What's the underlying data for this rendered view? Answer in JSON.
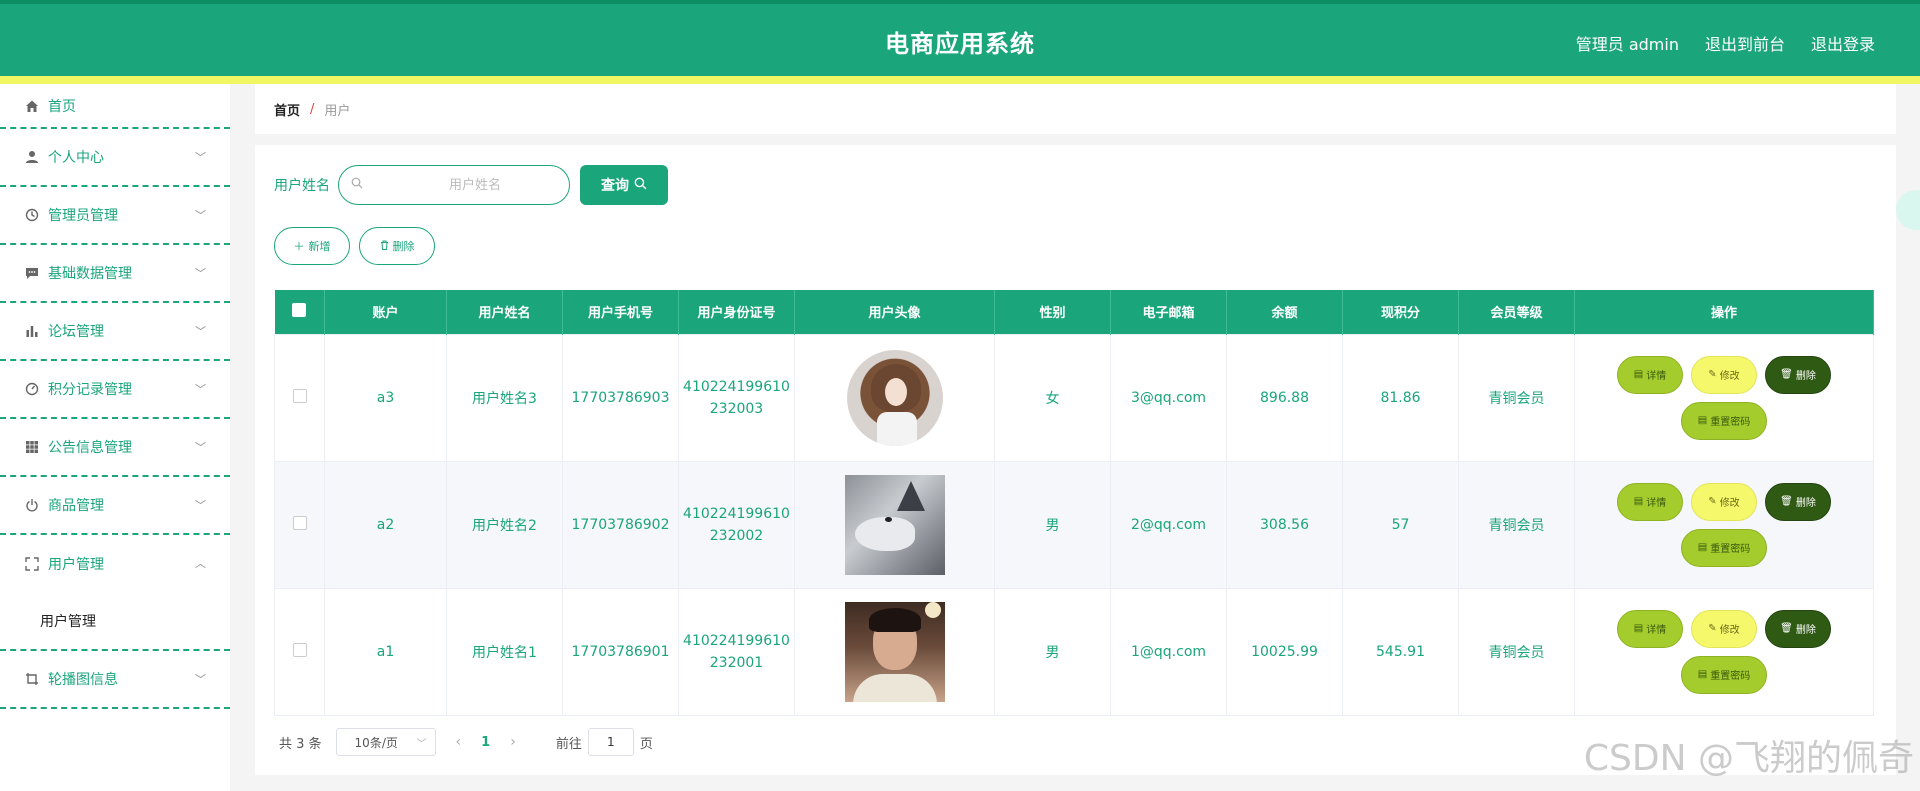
{
  "header": {
    "title": "电商应用系统",
    "admin_label": "管理员 admin",
    "to_front": "退出到前台",
    "logout": "退出登录"
  },
  "sidebar": {
    "items": [
      {
        "label": "首页",
        "icon": "home-icon"
      },
      {
        "label": "个人中心",
        "icon": "user-icon"
      },
      {
        "label": "管理员管理",
        "icon": "clock-icon"
      },
      {
        "label": "基础数据管理",
        "icon": "chat-icon"
      },
      {
        "label": "论坛管理",
        "icon": "bar-chart-icon"
      },
      {
        "label": "积分记录管理",
        "icon": "gauge-icon"
      },
      {
        "label": "公告信息管理",
        "icon": "grid-icon"
      },
      {
        "label": "商品管理",
        "icon": "power-icon"
      },
      {
        "label": "用户管理",
        "icon": "fullscreen-icon"
      },
      {
        "label": "轮播图信息",
        "icon": "crop-icon"
      }
    ],
    "submenu_user": "用户管理"
  },
  "breadcrumb": {
    "home": "首页",
    "separator": "/",
    "current": "用户"
  },
  "search": {
    "label": "用户姓名",
    "placeholder": "用户姓名",
    "value": "",
    "query_label": "查询"
  },
  "actions": {
    "add_label": "新增",
    "delete_label": "删除"
  },
  "table": {
    "columns": [
      "账户",
      "用户姓名",
      "用户手机号",
      "用户身份证号",
      "用户头像",
      "性别",
      "电子邮箱",
      "余额",
      "现积分",
      "会员等级",
      "操作"
    ],
    "rows": [
      {
        "account": "a3",
        "name": "用户姓名3",
        "phone": "17703786903",
        "id_line1": "410224199610",
        "id_line2": "232003",
        "gender": "女",
        "email": "3@qq.com",
        "balance": "896.88",
        "points": "81.86",
        "level": "青铜会员"
      },
      {
        "account": "a2",
        "name": "用户姓名2",
        "phone": "17703786902",
        "id_line1": "410224199610",
        "id_line2": "232002",
        "gender": "男",
        "email": "2@qq.com",
        "balance": "308.56",
        "points": "57",
        "level": "青铜会员"
      },
      {
        "account": "a1",
        "name": "用户姓名1",
        "phone": "17703786901",
        "id_line1": "410224199610",
        "id_line2": "232001",
        "gender": "男",
        "email": "1@qq.com",
        "balance": "10025.99",
        "points": "545.91",
        "level": "青铜会员"
      }
    ],
    "ops": {
      "detail": "详情",
      "edit": "修改",
      "delete": "删除",
      "reset": "重置密码"
    }
  },
  "pagination": {
    "total": "共 3 条",
    "page_size": "10条/页",
    "current_page": "1",
    "goto_label": "前往",
    "goto_value": "1",
    "page_unit": "页"
  },
  "watermark": "CSDN @飞翔的佩奇",
  "colors": {
    "primary": "#1ba57a",
    "header_stripe": "#f0f763",
    "detail_btn": "#a4cc2d",
    "edit_btn": "#f6f86b",
    "delete_btn": "#2f5a14"
  }
}
